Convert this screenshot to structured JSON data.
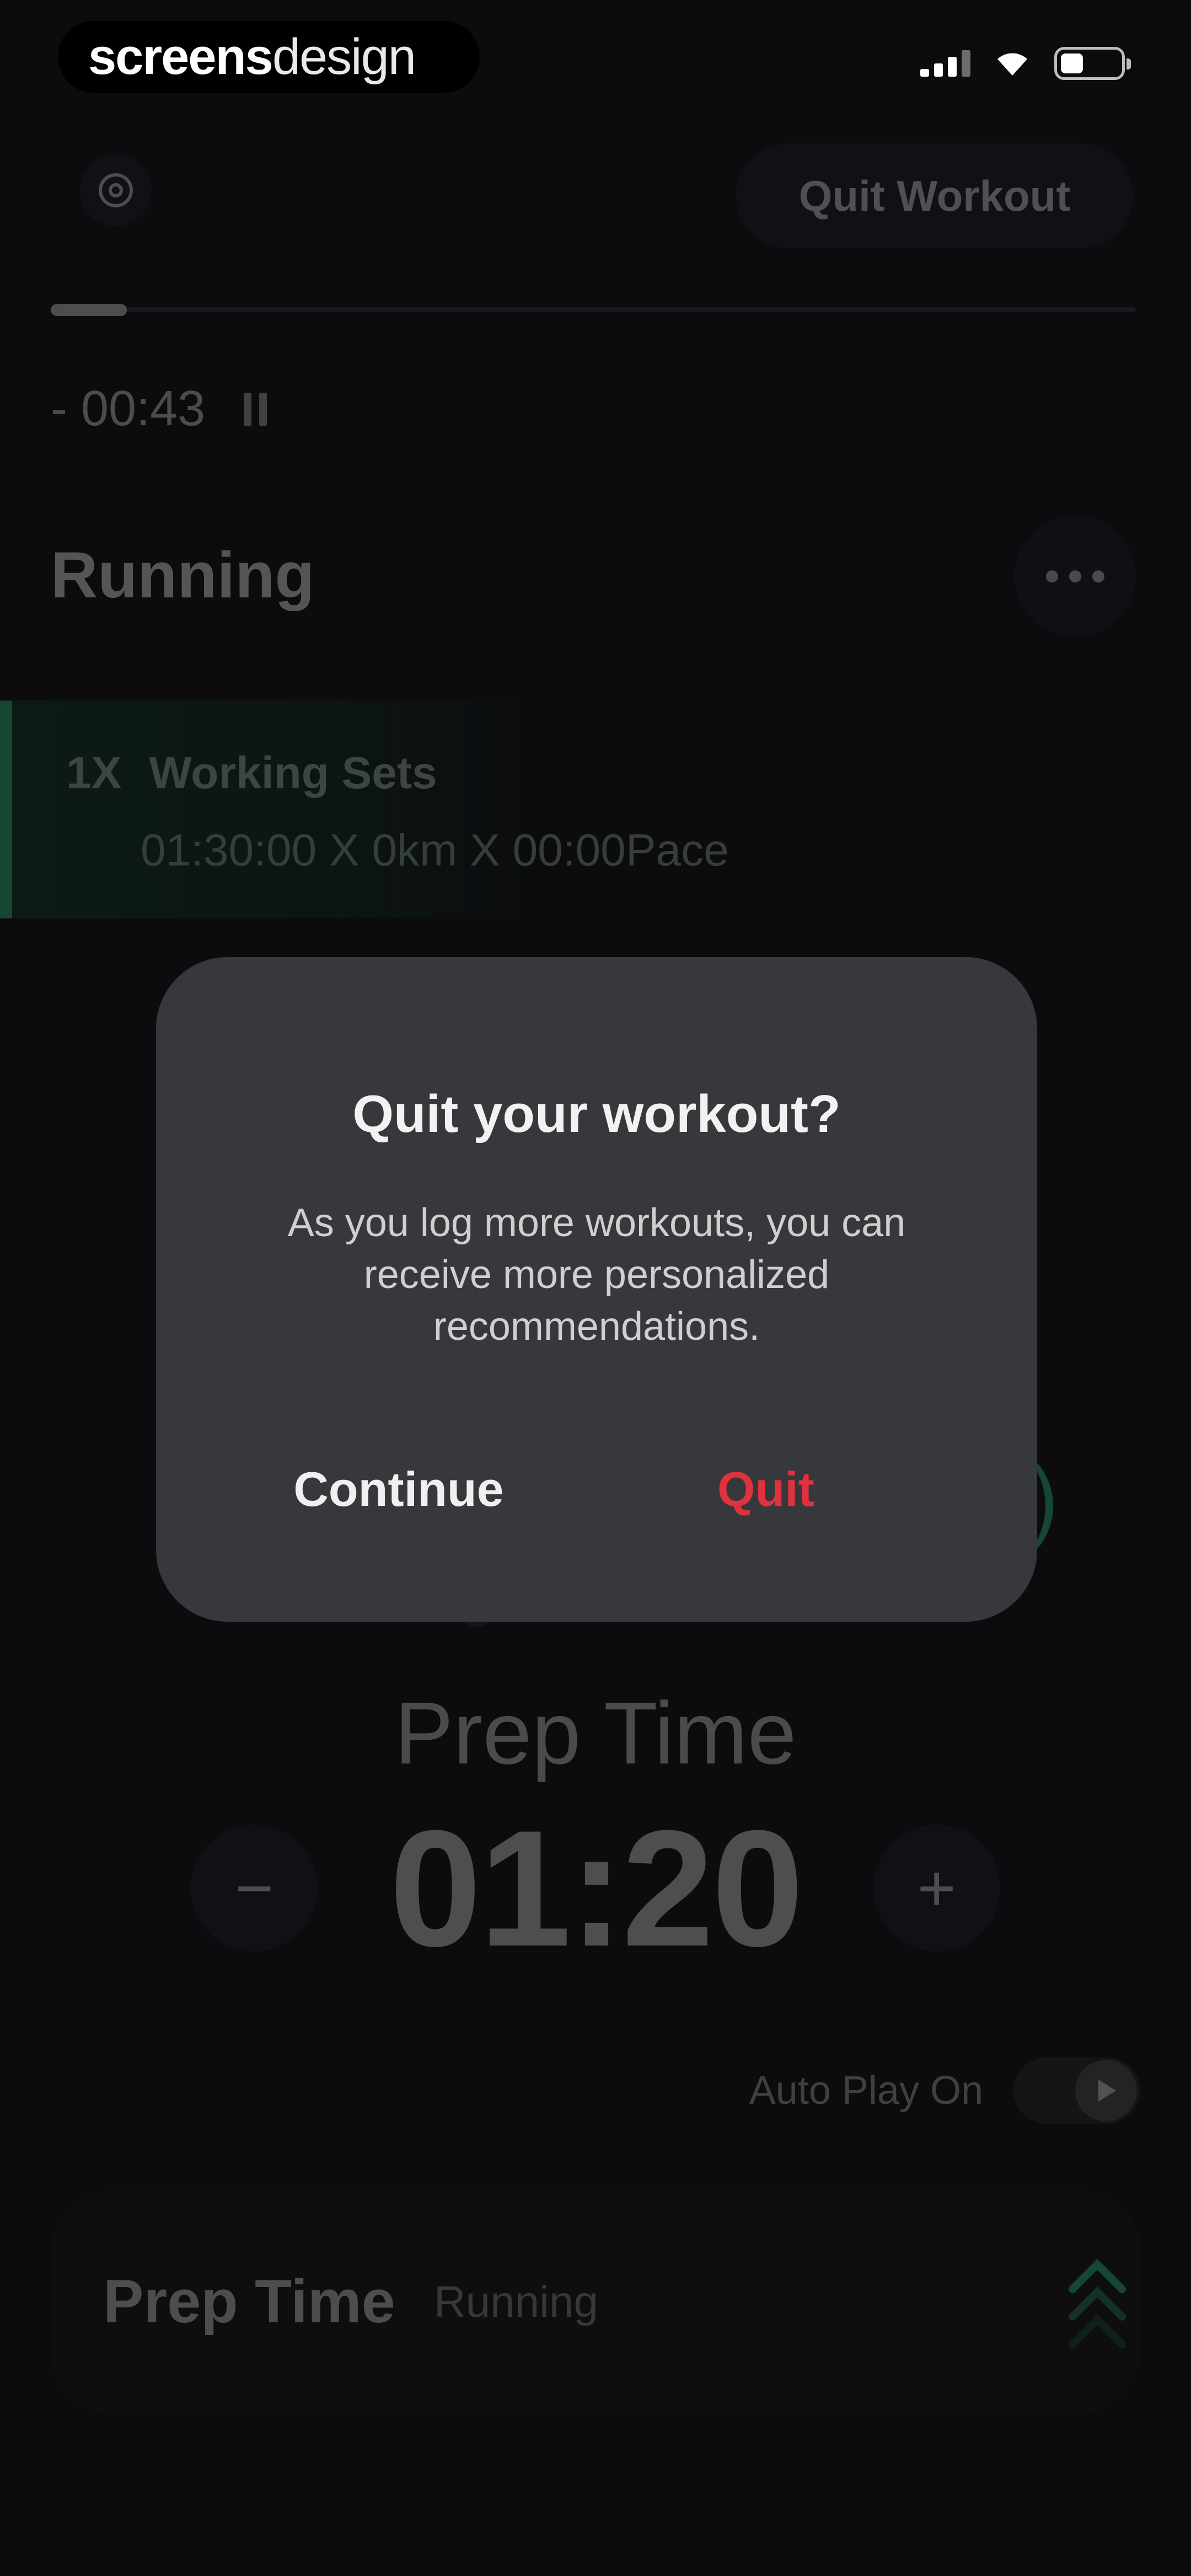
{
  "status_bar": {
    "brand_bold": "screens",
    "brand_light": "design",
    "icons": [
      "signal-icon",
      "wifi-icon",
      "battery-icon"
    ]
  },
  "header": {
    "settings_icon": "settings-icon",
    "quit_button_label": "Quit Workout"
  },
  "progress": {
    "completed_fraction": 0.07
  },
  "timer_bar": {
    "elapsed": "- 00:43",
    "pause_icon": "pause-icon"
  },
  "workout": {
    "title": "Running",
    "more_icon": "more-icon"
  },
  "set": {
    "count": "1X",
    "name": "Working Sets",
    "detail": "01:30:00 X 0km X 00:00Pace"
  },
  "prep": {
    "label": "Prep Time",
    "value": "01:20",
    "minus_label": "−",
    "plus_label": "+"
  },
  "autoplay": {
    "label": "Auto Play On",
    "enabled": true,
    "icon": "play-icon"
  },
  "bottom_card": {
    "title": "Prep Time",
    "subtitle": "Running",
    "icon": "chevron-up-icon"
  },
  "dialog": {
    "title": "Quit your workout?",
    "message": "As you log more workouts, you can receive more personalized recommendations.",
    "continue_label": "Continue",
    "quit_label": "Quit"
  },
  "colors": {
    "background": "#0c0c0e",
    "dialog": "#37383c",
    "accent_green": "#2fbf7d",
    "quit_red": "#e0323e"
  }
}
